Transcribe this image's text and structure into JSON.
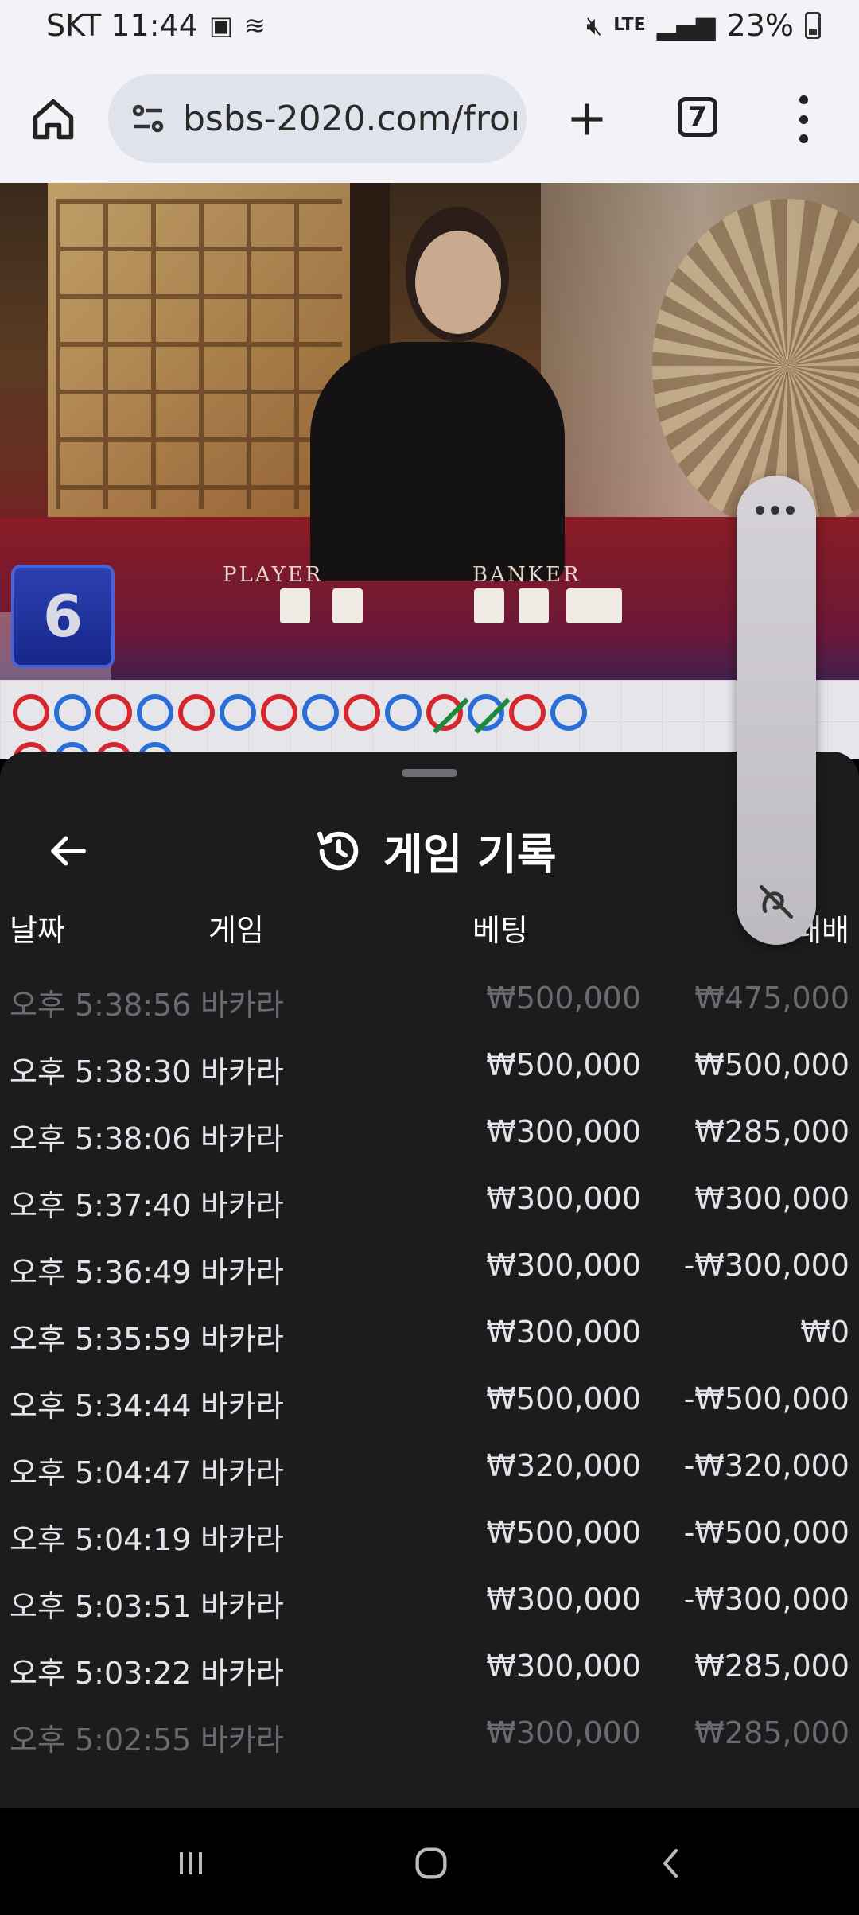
{
  "status_bar": {
    "carrier_time": "SKT 11:44",
    "network": "LTE",
    "battery": "23%"
  },
  "browser": {
    "url": "bsbs-2020.com/fron",
    "tab_count": "7"
  },
  "video": {
    "player_label": "PLAYER",
    "banker_label": "BANKER",
    "round_number": "6"
  },
  "history": {
    "title": "게임 기록",
    "columns": {
      "date": "날짜",
      "game": "게임",
      "bet": "베팅",
      "win": "승/패배"
    },
    "rows": [
      {
        "date": "오후 5:38:56",
        "game": "바카라",
        "bet": "₩500,000",
        "win": "₩475,000"
      },
      {
        "date": "오후 5:38:30",
        "game": "바카라",
        "bet": "₩500,000",
        "win": "₩500,000"
      },
      {
        "date": "오후 5:38:06",
        "game": "바카라",
        "bet": "₩300,000",
        "win": "₩285,000"
      },
      {
        "date": "오후 5:37:40",
        "game": "바카라",
        "bet": "₩300,000",
        "win": "₩300,000"
      },
      {
        "date": "오후 5:36:49",
        "game": "바카라",
        "bet": "₩300,000",
        "win": "-₩300,000"
      },
      {
        "date": "오후 5:35:59",
        "game": "바카라",
        "bet": "₩300,000",
        "win": "₩0"
      },
      {
        "date": "오후 5:34:44",
        "game": "바카라",
        "bet": "₩500,000",
        "win": "-₩500,000"
      },
      {
        "date": "오후 5:04:47",
        "game": "바카라",
        "bet": "₩320,000",
        "win": "-₩320,000"
      },
      {
        "date": "오후 5:04:19",
        "game": "바카라",
        "bet": "₩500,000",
        "win": "-₩500,000"
      },
      {
        "date": "오후 5:03:51",
        "game": "바카라",
        "bet": "₩300,000",
        "win": "-₩300,000"
      },
      {
        "date": "오후 5:03:22",
        "game": "바카라",
        "bet": "₩300,000",
        "win": "₩285,000"
      },
      {
        "date": "오후 5:02:55",
        "game": "바카라",
        "bet": "₩300,000",
        "win": "₩285,000"
      }
    ]
  },
  "colors": {
    "sheet_bg": "#1c1c1e",
    "bead_red": "#d8262f",
    "bead_blue": "#2a6fd8"
  }
}
